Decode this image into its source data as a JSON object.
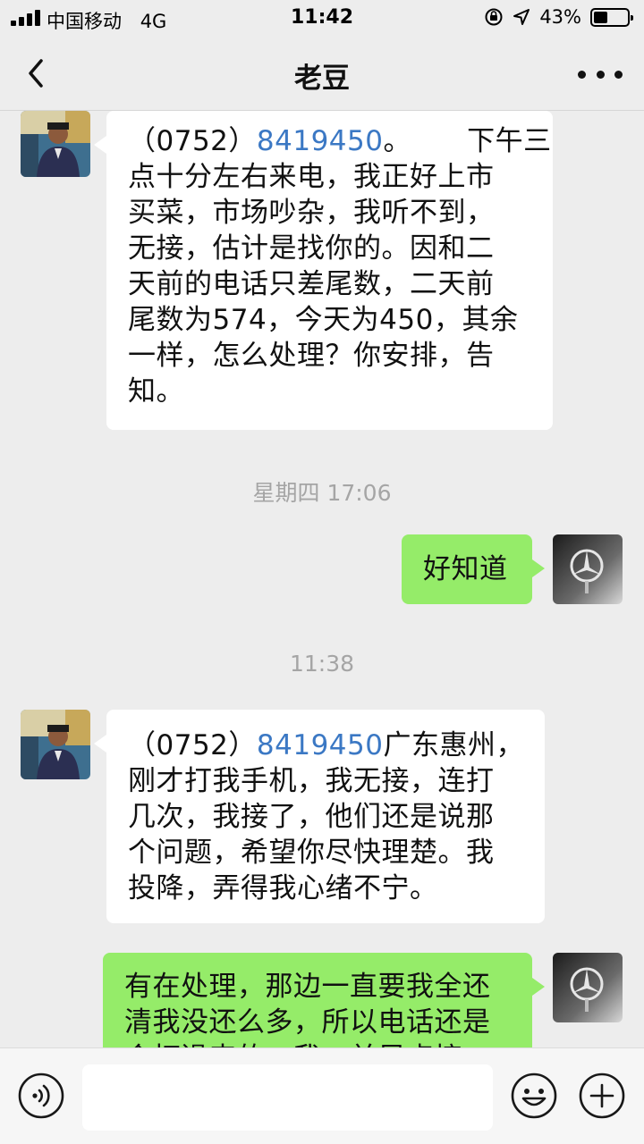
{
  "status_bar": {
    "carrier": "中国移动",
    "network": "4G",
    "time": "11:42",
    "battery_percent": "43%",
    "battery_level": 0.43
  },
  "nav": {
    "title": "老豆",
    "back_icon": "chevron-left-icon",
    "more_icon": "more-dots-icon"
  },
  "messages": [
    {
      "side": "left",
      "lines": [
        {
          "pre": "（0752）",
          "link": "8419450",
          "post": "。      下午三"
        },
        {
          "text": "点十分左右来电，我正好上市"
        },
        {
          "text": "买菜，市场吵杂，我听不到，"
        },
        {
          "text": "无接，估计是找你的。因和二"
        },
        {
          "text": "天前的电话只差尾数，二天前"
        },
        {
          "text": "尾数为574，今天为450，其余"
        },
        {
          "text": "一样，怎么处理？你安排，告"
        },
        {
          "text": "知。"
        }
      ]
    },
    {
      "timestamp": "星期四 17:06"
    },
    {
      "side": "right",
      "lines": [
        {
          "text": "好知道"
        }
      ]
    },
    {
      "timestamp": "11:38"
    },
    {
      "side": "left",
      "lines": [
        {
          "pre": "（0752）",
          "link": "8419450",
          "post": "广东惠州，"
        },
        {
          "text": "刚才打我手机，我无接，连打"
        },
        {
          "text": "几次，我接了，他们还是说那"
        },
        {
          "text": "个问题，希望你尽快理楚。我"
        },
        {
          "text": "投降，弄得我心绪不宁。"
        }
      ]
    },
    {
      "side": "right",
      "lines": [
        {
          "text": "有在处理，那边一直要我全还"
        },
        {
          "text": "清我没还么多，所以电话还是"
        },
        {
          "text": "会打過来的，我一并早点搞"
        }
      ]
    }
  ],
  "colors": {
    "background": "#ededed",
    "bubble_self": "#95ec69",
    "bubble_other": "#ffffff",
    "link": "#3b78c4"
  },
  "input_bar": {
    "voice_icon": "voice-icon",
    "emoji_icon": "emoji-icon",
    "plus_icon": "plus-icon",
    "input_value": ""
  }
}
